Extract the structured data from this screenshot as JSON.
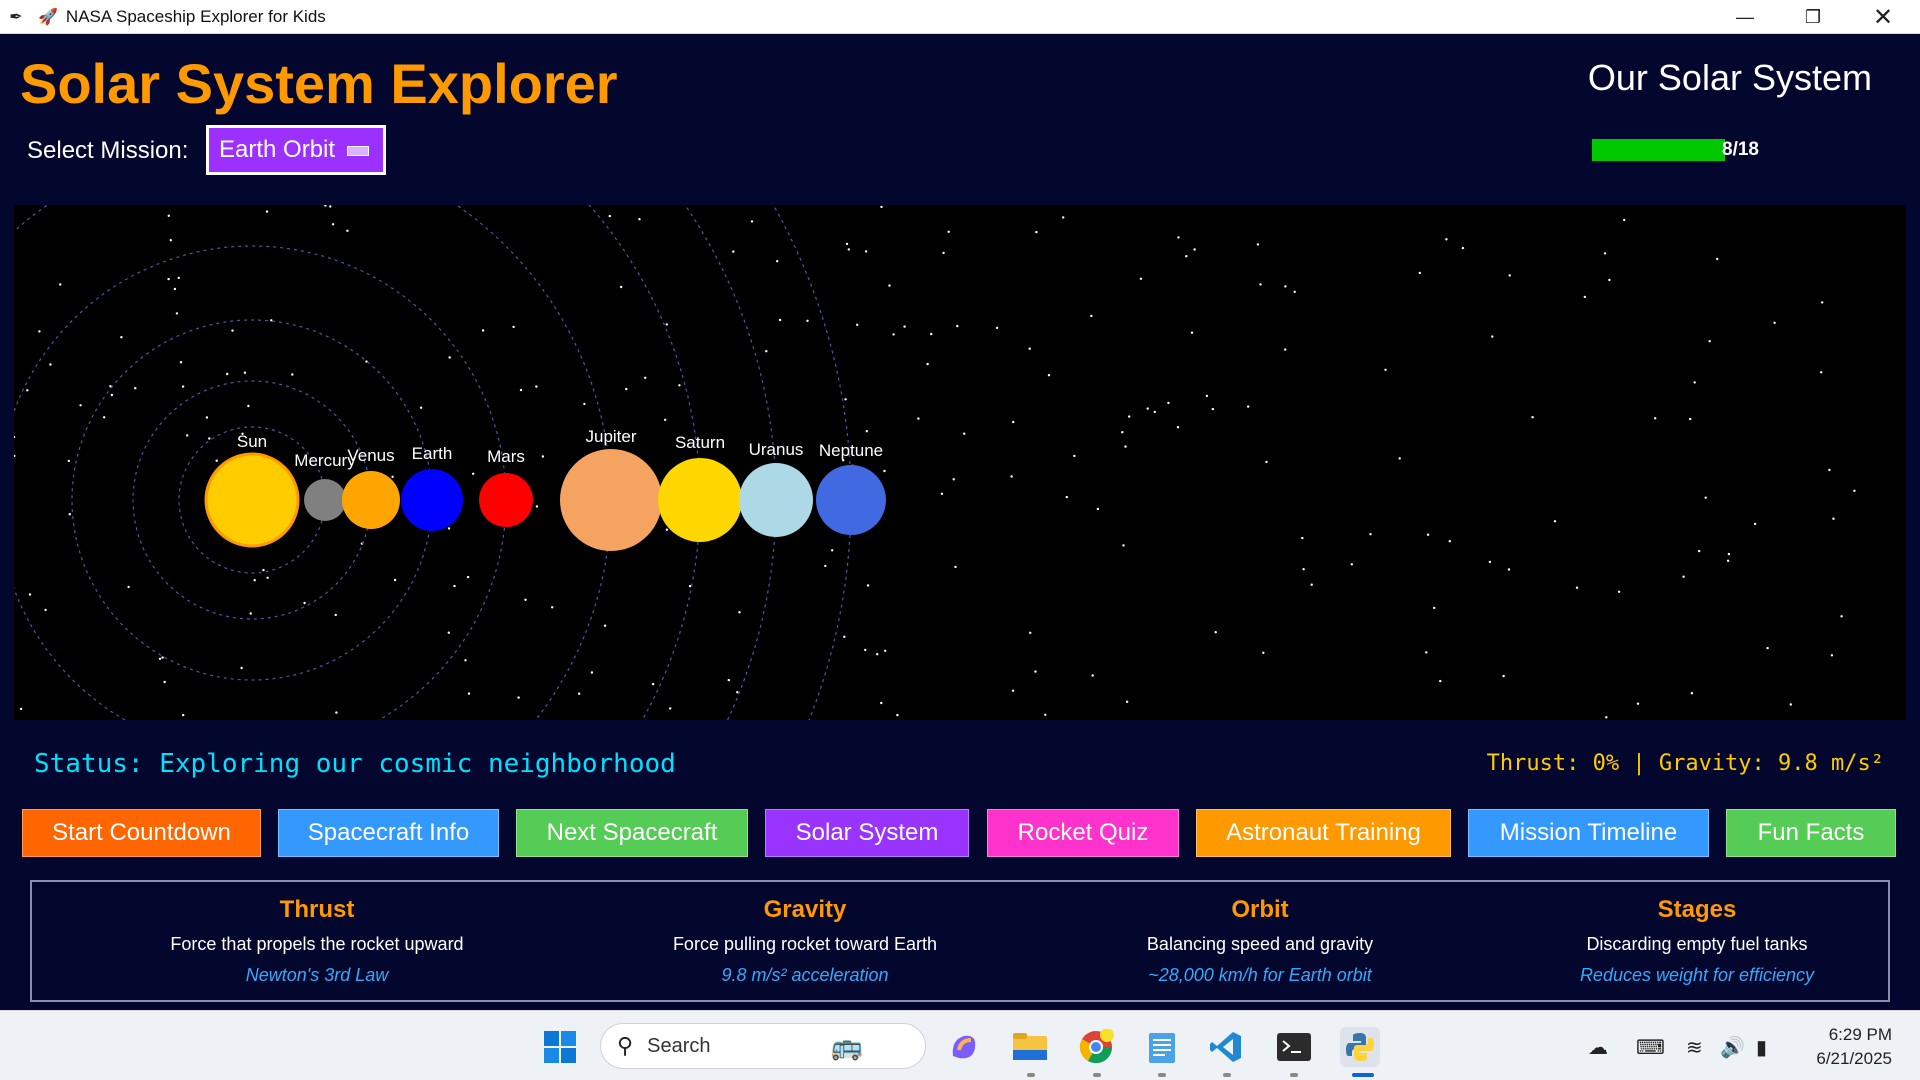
{
  "window": {
    "title": "NASA Spaceship Explorer for Kids",
    "icons": [
      "feather-icon",
      "rocket-icon"
    ],
    "controls": [
      "minimize",
      "restore",
      "close"
    ]
  },
  "header": {
    "app_title": "Solar System Explorer",
    "section_title": "Our Solar System",
    "mission_label": "Select Mission:",
    "mission_value": "Earth Orbit",
    "progress_text": "8/18",
    "progress_fraction": 0.444,
    "progress_color": "#00c800"
  },
  "solar_system": {
    "planets": [
      {
        "name": "Sun",
        "color": "#ffcc00"
      },
      {
        "name": "Mercury",
        "color": "#808080"
      },
      {
        "name": "Venus",
        "color": "#ffa500"
      },
      {
        "name": "Earth",
        "color": "#0000ff"
      },
      {
        "name": "Mars",
        "color": "#ff0000"
      },
      {
        "name": "Jupiter",
        "color": "#f4a460"
      },
      {
        "name": "Saturn",
        "color": "#ffd700"
      },
      {
        "name": "Uranus",
        "color": "#add8e6"
      },
      {
        "name": "Neptune",
        "color": "#4169e1"
      }
    ]
  },
  "status": {
    "text": "Status: Exploring our cosmic neighborhood",
    "metrics": "Thrust: 0% | Gravity: 9.8 m/s²"
  },
  "buttons": [
    {
      "label": "Start Countdown",
      "color": "#ff6600"
    },
    {
      "label": "Spacecraft Info",
      "color": "#3399ff"
    },
    {
      "label": "Next Spacecraft",
      "color": "#55cc55"
    },
    {
      "label": "Solar System",
      "color": "#9933ff"
    },
    {
      "label": "Rocket Quiz",
      "color": "#ff33cc"
    },
    {
      "label": "Astronaut Training",
      "color": "#ff9900"
    },
    {
      "label": "Mission Timeline",
      "color": "#3399ff"
    },
    {
      "label": "Fun Facts",
      "color": "#55cc55"
    }
  ],
  "info": [
    {
      "heading": "Thrust",
      "desc": "Force that propels the rocket upward",
      "note": "Newton's 3rd Law"
    },
    {
      "heading": "Gravity",
      "desc": "Force pulling rocket toward Earth",
      "note": "9.8 m/s² acceleration"
    },
    {
      "heading": "Orbit",
      "desc": "Balancing speed and gravity",
      "note": "~28,000 km/h for Earth orbit"
    },
    {
      "heading": "Stages",
      "desc": "Discarding empty fuel tanks",
      "note": "Reduces weight for efficiency"
    }
  ],
  "taskbar": {
    "search_placeholder": "Search",
    "apps": [
      "windows-start-icon",
      "copilot-icon",
      "file-explorer-icon",
      "chrome-icon",
      "notepad-icon",
      "vscode-icon",
      "terminal-icon",
      "python-icon"
    ],
    "tray": [
      "onedrive-icon",
      "keyboard-icon",
      "wifi-icon",
      "volume-icon",
      "battery-icon"
    ],
    "time": "6:29 PM",
    "date": "6/21/2025"
  }
}
